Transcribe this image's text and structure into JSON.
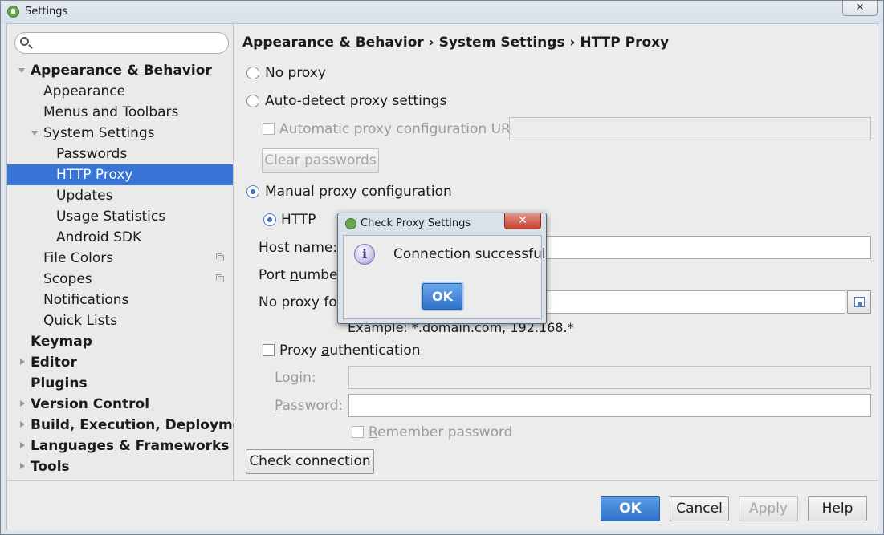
{
  "window": {
    "title": "Settings",
    "close_symbol": "✕"
  },
  "search": {
    "value": "",
    "placeholder": ""
  },
  "sidebar": {
    "items": [
      {
        "label": "Appearance & Behavior"
      },
      {
        "label": "Appearance"
      },
      {
        "label": "Menus and Toolbars"
      },
      {
        "label": "System Settings"
      },
      {
        "label": "Passwords"
      },
      {
        "label": "HTTP Proxy"
      },
      {
        "label": "Updates"
      },
      {
        "label": "Usage Statistics"
      },
      {
        "label": "Android SDK"
      },
      {
        "label": "File Colors"
      },
      {
        "label": "Scopes"
      },
      {
        "label": "Notifications"
      },
      {
        "label": "Quick Lists"
      },
      {
        "label": "Keymap"
      },
      {
        "label": "Editor"
      },
      {
        "label": "Plugins"
      },
      {
        "label": "Version Control"
      },
      {
        "label": "Build, Execution, Deployment"
      },
      {
        "label": "Languages & Frameworks"
      },
      {
        "label": "Tools"
      }
    ]
  },
  "panel": {
    "breadcrumb": "Appearance & Behavior › System Settings › HTTP Proxy",
    "no_proxy": "No proxy",
    "auto_detect": "Auto-detect proxy settings",
    "auto_url_label": "Automatic proxy configuration URL:",
    "auto_url_value": "",
    "clear_passwords": "Clear passwords",
    "manual": "Manual proxy configuration",
    "http": "HTTP",
    "host_label_first": "H",
    "host_label_rest": "ost name:",
    "host_value": "",
    "port_label_first": "Port ",
    "port_label_u": "n",
    "port_label_rest": "umber:",
    "no_proxy_for_label": "No proxy for:",
    "no_proxy_for_value": "",
    "example": "Example: *.domain.com, 192.168.*",
    "proxy_auth_pre": "Proxy ",
    "proxy_auth_u": "a",
    "proxy_auth_rest": "uthentication",
    "login_label": "Login:",
    "login_value": "",
    "password_label_first": "P",
    "password_label_rest": "assword:",
    "password_value": "",
    "remember_first": "R",
    "remember_rest": "emember password",
    "check_connection": "Check connection"
  },
  "footer": {
    "ok": "OK",
    "cancel": "Cancel",
    "apply": "Apply",
    "help": "Help"
  },
  "dialog": {
    "title": "Check Proxy Settings",
    "message": "Connection successful",
    "ok": "OK",
    "close_symbol": "✕",
    "icon_glyph": "i"
  },
  "colors": {
    "selection": "#3875d7",
    "primary_button": "#2f72c8"
  }
}
